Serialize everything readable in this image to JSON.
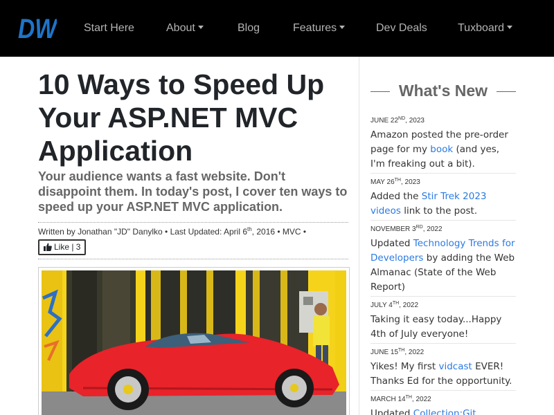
{
  "nav": {
    "logo": "DW",
    "items": [
      {
        "label": "Start Here",
        "dropdown": false
      },
      {
        "label": "About",
        "dropdown": true
      },
      {
        "label": "Blog",
        "dropdown": false
      },
      {
        "label": "Features",
        "dropdown": true
      },
      {
        "label": "Dev Deals",
        "dropdown": false
      },
      {
        "label": "Tuxboard",
        "dropdown": true
      }
    ]
  },
  "article": {
    "title": "10 Ways to Speed Up Your ASP.NET MVC Application",
    "subtitle": "Your audience wants a fast website. Don't disappoint them. In today's post, I cover ten ways to speed up your ASP.NET MVC application.",
    "byline_prefix": "Written by Jonathan \"JD\" Danylko • Last Updated: April 6",
    "byline_sup": "th",
    "byline_suffix": ", 2016 • MVC •",
    "like_label": "Like | 3"
  },
  "sidebar": {
    "title": "What's New",
    "items": [
      {
        "date_pre": "June 22",
        "date_sup": "ND",
        "date_post": ", 2023",
        "text_pre": "Amazon posted the pre-order page for my ",
        "link": "book",
        "text_post": " (and yes, I'm freaking out a bit)."
      },
      {
        "date_pre": "May 26",
        "date_sup": "TH",
        "date_post": ", 2023",
        "text_pre": "Added the ",
        "link": "Stir Trek 2023 videos",
        "text_post": " link to the post."
      },
      {
        "date_pre": "November 3",
        "date_sup": "RD",
        "date_post": ", 2022",
        "text_pre": "Updated ",
        "link": "Technology Trends for Developers",
        "text_post": " by adding the Web Almanac (State of the Web Report)"
      },
      {
        "date_pre": "July 4",
        "date_sup": "TH",
        "date_post": ", 2022",
        "text_pre": "Taking it easy today...Happy 4th of July everyone!",
        "link": "",
        "text_post": ""
      },
      {
        "date_pre": "June 15",
        "date_sup": "TH",
        "date_post": ", 2022",
        "text_pre": "Yikes! My first ",
        "link": "vidcast",
        "text_post": " EVER! Thanks Ed for the opportunity."
      },
      {
        "date_pre": "March 14",
        "date_sup": "TH",
        "date_post": ", 2022",
        "text_pre": "Updated ",
        "link": "Collection:Git Resources",
        "text_post": ""
      }
    ]
  },
  "colors": {
    "navbar_bg": "#000000",
    "logo_blue": "#1e74c8",
    "link": "#2a7ae2",
    "car_red": "#e8232a",
    "wall_yellow": "#f5d31a"
  }
}
